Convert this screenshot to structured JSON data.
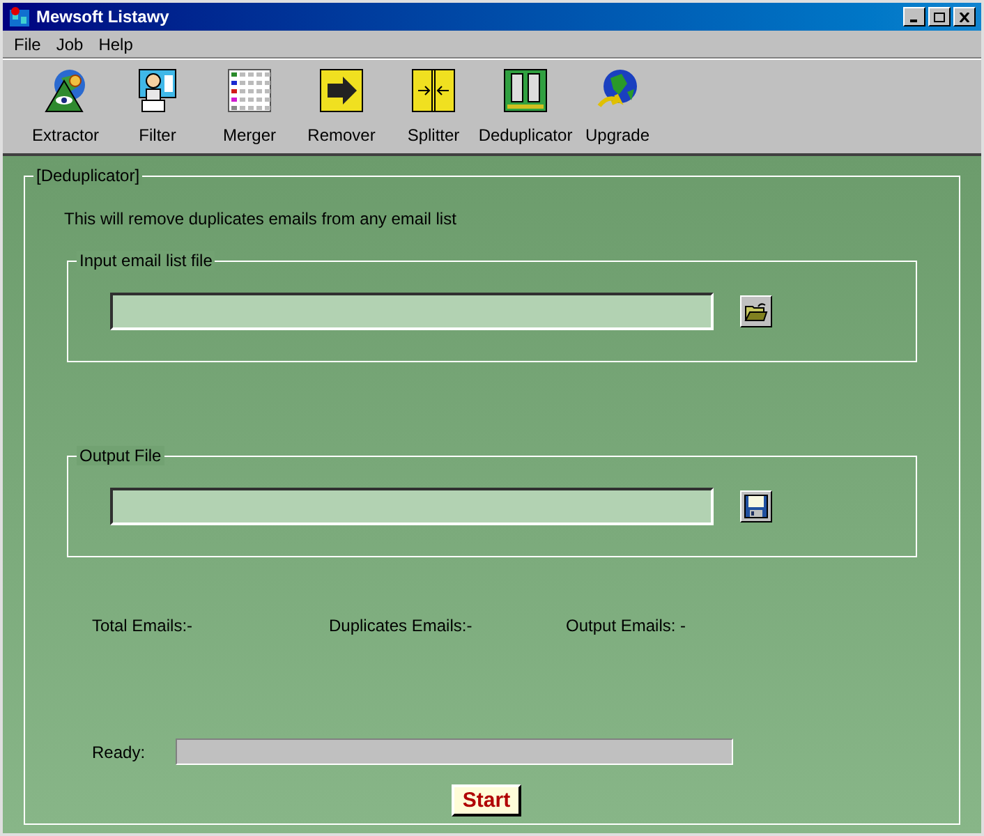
{
  "window": {
    "title": "Mewsoft Listawy"
  },
  "menu": [
    "File",
    "Job",
    "Help"
  ],
  "toolbar": [
    {
      "label": "Extractor",
      "kind": "extractor"
    },
    {
      "label": "Filter",
      "kind": "filter"
    },
    {
      "label": "Merger",
      "kind": "merger"
    },
    {
      "label": "Remover",
      "kind": "remover"
    },
    {
      "label": "Splitter",
      "kind": "splitter"
    },
    {
      "label": "Deduplicator",
      "kind": "deduplicator"
    },
    {
      "label": "Upgrade",
      "kind": "upgrade"
    }
  ],
  "panel": {
    "title": "[Deduplicator]",
    "description": "This will remove duplicates emails from any email list",
    "input_group": {
      "title": "Input email list file"
    },
    "output_group": {
      "title": "Output File"
    },
    "stats": [
      "Total Emails:-",
      "Duplicates Emails:-",
      "Output Emails: -"
    ],
    "status": {
      "label": "Ready:",
      "level": 0
    },
    "start_button": "Start"
  }
}
